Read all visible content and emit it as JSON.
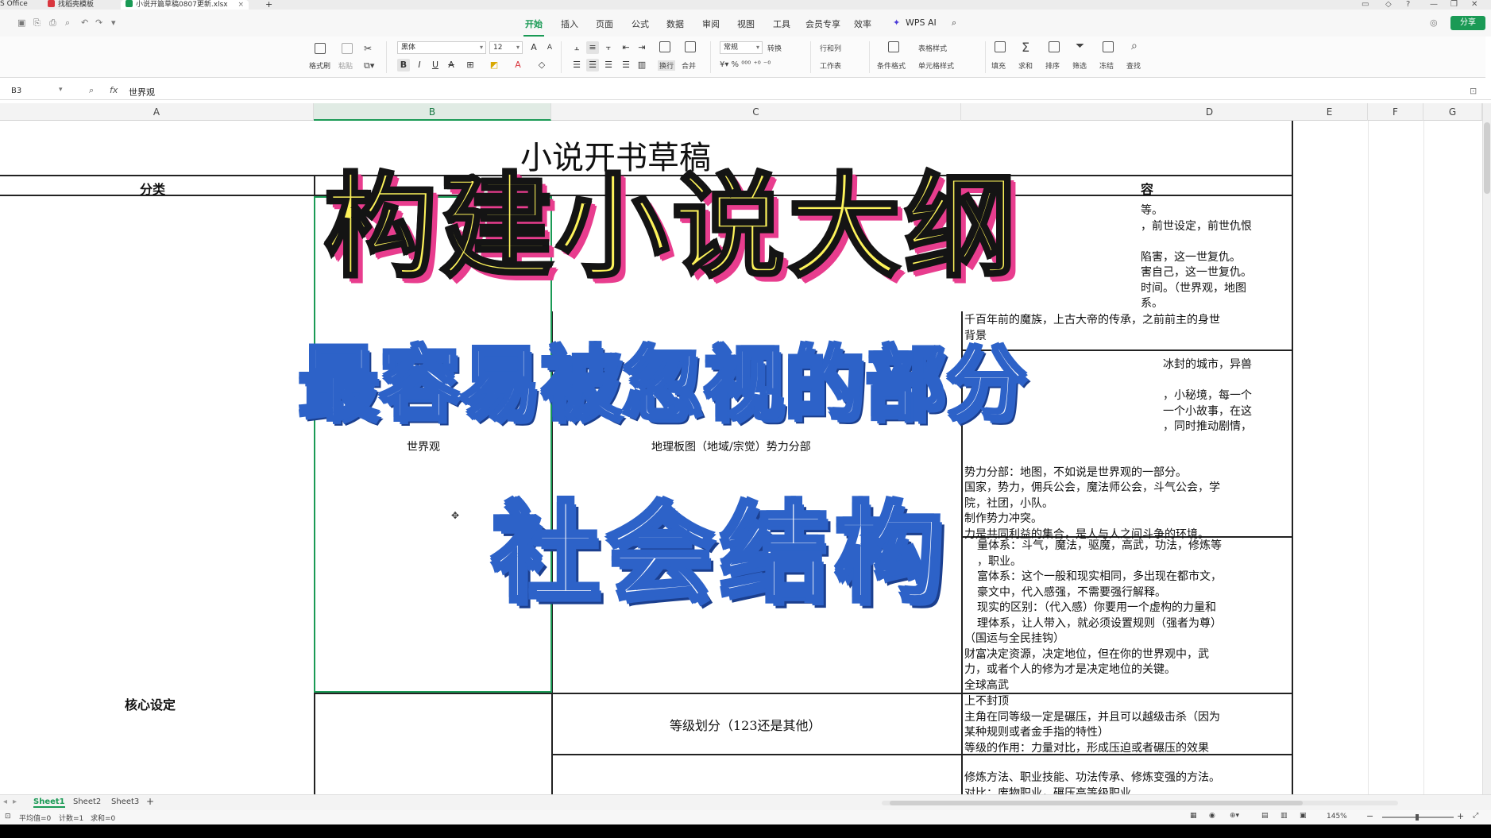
{
  "titlebar": {
    "app_label": "S Office",
    "tabs": [
      "找稻壳模板",
      "小说开篇草稿0807更新.xlsx"
    ],
    "new_tab": "+"
  },
  "menu": {
    "items": [
      "开始",
      "插入",
      "页面",
      "公式",
      "数据",
      "审阅",
      "视图",
      "工具",
      "会员专享",
      "效率"
    ],
    "active": "开始",
    "wps_ai": "WPS AI",
    "share": "分享"
  },
  "ribbon": {
    "format_painter": "格式刷",
    "paste": "粘贴",
    "font_name": "黑体",
    "font_size": "12",
    "wrap": "换行",
    "merge": "合并",
    "number_format": "常规",
    "convert": "转换",
    "row_col": "行和列",
    "worksheet": "工作表",
    "cond_format": "条件格式",
    "table_style": "表格样式",
    "cell_style": "单元格样式",
    "fill": "填充",
    "sum": "求和",
    "sort": "排序",
    "filter": "筛选",
    "freeze": "冻结",
    "find": "查找"
  },
  "formula_bar": {
    "cell_ref": "B3",
    "fx": "fx",
    "value": "世界观"
  },
  "columns": [
    "A",
    "B",
    "C",
    "D",
    "E",
    "F",
    "G"
  ],
  "sheet": {
    "title": "小说开书草稿",
    "header_category": "分类",
    "header_content_partial": "容",
    "category_core": "核心设定",
    "category_world_partial": "世界观",
    "c_row_map": "地理板图（地域/宗觉）势力分部",
    "c_row_level": "等级划分（123还是其他）",
    "d_lines_1": [
      "等。",
      "，前世设定，前世仇恨",
      "",
      "陷害，这一世复仇。",
      "害自己，这一世复仇。",
      "时间。（世界观，地图",
      "系。",
      "千百年前的魔族，上古大帝的传承，之前前主的身世",
      "背景"
    ],
    "d_lines_2": [
      "冰封的城市，异兽",
      "",
      "，小秘境，每一个",
      "一个小故事，在这",
      "，同时推动剧情，",
      "",
      "势力分部：地图，不如说是世界观的一部分。",
      "国家，势力，佣兵公会，魔法师公会，斗气公会，学",
      "院，社团，小队。",
      "制作势力冲突。",
      "力是共同利益的集合，是人与人之间斗争的环境。"
    ],
    "d_lines_3": [
      "量体系：斗气，魔法，驱魔，高武，功法，修炼等",
      "，职业。",
      "富体系：这个一般和现实相同，多出现在都市文，",
      "豪文中，代入感强，不需要强行解释。",
      "现实的区别：（代入感）你要用一个虚构的力量和",
      "理体系，让人带入，就必须设置规则（强者为尊）",
      "（国运与全民挂钩）",
      "财富决定资源，决定地位，但在你的世界观中，武",
      "力，或者个人的修为才是决定地位的关键。",
      "全球高武"
    ],
    "d_lines_4": [
      "上不封顶",
      "主角在同等级一定是碾压，并且可以越级击杀（因为",
      "某种规则或者金手指的特性）",
      "等级的作用：力量对比，形成压迫或者碾压的效果"
    ],
    "d_lines_5": [
      "修炼方法、职业技能、功法传承、修炼变强的方法。",
      "对比：废物职业，碾压高等级职业"
    ]
  },
  "overlays": {
    "line1": "构建小说大纲",
    "line2": "最容易被忽视的部分",
    "line3": "社会结构",
    "colors": {
      "yellow": "#fdf35a",
      "pink": "#e83d8e",
      "blue": "#2d62c8",
      "white": "#ffffff"
    }
  },
  "sheet_tabs": [
    "Sheet1",
    "Sheet2",
    "Sheet3"
  ],
  "active_sheet": "Sheet1",
  "status": {
    "avg": "平均值=0",
    "count": "计数=1",
    "sum": "求和=0",
    "zoom": "145%"
  }
}
